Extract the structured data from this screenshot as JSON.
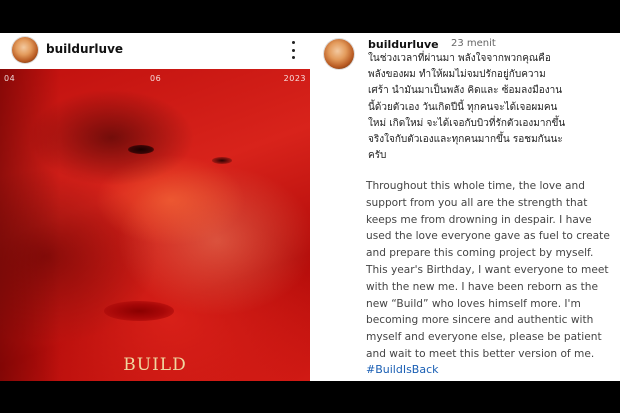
{
  "post": {
    "username": "buildurluve",
    "cover": {
      "date_day": "04",
      "date_month": "06",
      "date_year": "2023",
      "logo_text": "BUILD"
    }
  },
  "caption": {
    "username": "buildurluve",
    "timestamp": "23 menit",
    "thai_text": "ในช่วงเวลาที่ผ่านมา พลังใจจากพวกคุณคือ\nพลังของผม ทำให้ผมไม่จมปรักอยู่กับความ\nเศร้า นำมันมาเป็นพลัง คิดและ ซ้อมลงมืองาน\nนี้ด้วยตัวเอง วันเกิดปีนี้ ทุกคนจะได้เจอผมคน\nใหม่ เกิดใหม่ จะได้เจอกับบิวที่รักตัวเองมากขึ้น\nจริงใจกับตัวเองและทุกคนมากขึ้น รอชมกันนะ\nครับ",
    "english_text": "Throughout this whole time, the love and support from you all are the strength that keeps me from drowning in despair. I have used the love everyone gave as fuel to create and prepare this coming project by myself. This year's Birthday, I want everyone to meet with the new me. I have been reborn as the new “Build” who loves himself more. I'm becoming more sincere and authentic with myself and everyone else, please be patient and wait to meet this better version of me.",
    "hashtag": "#BuildIsBack"
  },
  "colors": {
    "background": "#000000",
    "panel": "#ffffff",
    "cover_red": "#c0100e",
    "hashtag_blue": "#1a5fb4"
  },
  "icons": {
    "more": "more-vertical-icon"
  }
}
